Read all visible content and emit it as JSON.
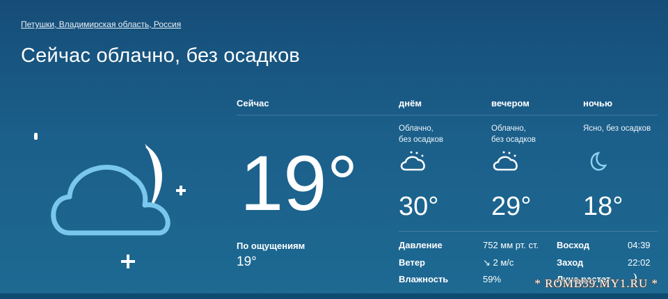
{
  "location": "Петушки, Владимирская область, Россия",
  "headline": "Сейчас облачно, без осадков",
  "now": {
    "label": "Сейчас",
    "temp": "19°",
    "feels_label": "По ощущениям",
    "feels_value": "19°",
    "icon": "cloud-moon-icon"
  },
  "periods": [
    {
      "label": "днём",
      "desc1": "Облачно,",
      "desc2": "без осадков",
      "temp": "30°",
      "icon": "cloud-sun-icon"
    },
    {
      "label": "вечером",
      "desc1": "Облачно,",
      "desc2": "без осадков",
      "temp": "29°",
      "icon": "cloud-sun-icon"
    },
    {
      "label": "ночью",
      "desc1": "Ясно, без осадков",
      "desc2": "",
      "temp": "18°",
      "icon": "moon-icon"
    }
  ],
  "details": {
    "pressure_label": "Давление",
    "pressure_value": "752 мм рт. ст.",
    "wind_label": "Ветер",
    "wind_arrow": "↘",
    "wind_value": "2 м/с",
    "humidity_label": "Влажность",
    "humidity_value": "59%",
    "sunrise_label": "Восход",
    "sunrise_value": "04:39",
    "sunset_label": "Заход",
    "sunset_value": "22:02",
    "moon_label": "Луна растет"
  },
  "watermark": "* ROMB39.MY1.RU *",
  "colors": {
    "background": "#1b5f8a",
    "icon_stroke": "#79c7ec",
    "moon_fill": "#ffffff"
  }
}
